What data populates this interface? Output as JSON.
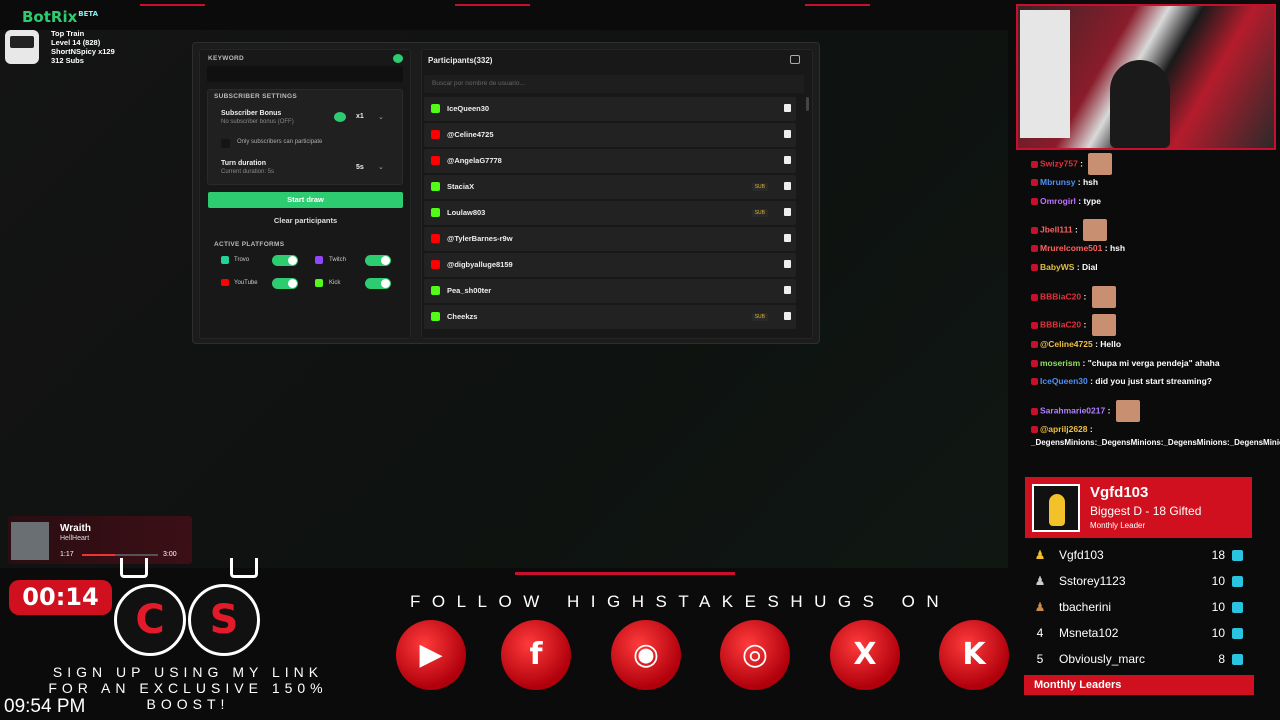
{
  "botrix": {
    "name": "BotRix",
    "beta": "BETA",
    "info": [
      "Top Train",
      "Level 14 (828)",
      "ShortNSpicy x129",
      "312 Subs"
    ]
  },
  "giveaway": {
    "keyword_label": "KEYWORD",
    "subscriber_settings_label": "SUBSCRIBER SETTINGS",
    "subscriber_bonus_label": "Subscriber Bonus",
    "subscriber_bonus_desc": "No subscriber bonus (OFF)",
    "multiplier": "x1",
    "only_subs_label": "Only subscribers can participate",
    "turn_duration_label": "Turn duration",
    "turn_duration_desc": "Current duration: 5s",
    "turn_duration_value": "5s",
    "start_draw": "Start draw",
    "clear_participants": "Clear participants",
    "active_platforms_label": "ACTIVE PLATFORMS",
    "platforms": [
      "Trovo",
      "Twitch",
      "YouTube",
      "Kick"
    ],
    "participants_title": "Participants(332)",
    "search_placeholder": "Buscar por nombre de usuario...",
    "participants": [
      {
        "name": "IceQueen30",
        "platform": "kick",
        "sub": false
      },
      {
        "name": "@Celine4725",
        "platform": "youtube",
        "sub": false
      },
      {
        "name": "@AngelaG7778",
        "platform": "youtube",
        "sub": false
      },
      {
        "name": "StaciaX",
        "platform": "kick",
        "sub": true
      },
      {
        "name": "Loulaw803",
        "platform": "kick",
        "sub": true
      },
      {
        "name": "@TylerBarnes-r9w",
        "platform": "youtube",
        "sub": false
      },
      {
        "name": "@digbyalluge8159",
        "platform": "youtube",
        "sub": false
      },
      {
        "name": "Pea_sh00ter",
        "platform": "kick",
        "sub": false
      },
      {
        "name": "Cheekzs",
        "platform": "kick",
        "sub": true
      }
    ],
    "sub_badge": "SUB"
  },
  "chat": [
    {
      "user": "Swizy757",
      "msg": "",
      "color": "#e0323c"
    },
    {
      "user": "Mbrunsy",
      "msg": "hsh",
      "color": "#4f8ff7"
    },
    {
      "user": "Omrogirl",
      "msg": "type",
      "color": "#c070ff"
    },
    {
      "user": "Jbell111",
      "msg": "",
      "color": "#ff6060"
    },
    {
      "user": "Mrurelcome501",
      "msg": "hsh",
      "color": "#ff6060"
    },
    {
      "user": "BabyWS",
      "msg": "Dial",
      "color": "#e0c040"
    },
    {
      "user": "BBBiaC20",
      "msg": "",
      "color": "#e0323c"
    },
    {
      "user": "BBBiaC20",
      "msg": "",
      "color": "#e0323c"
    },
    {
      "user": "@Celine4725",
      "msg": "Hello",
      "color": "#f0c040"
    },
    {
      "user": "moserism",
      "msg": "\"chupa mi verga pendeja\" ahaha",
      "color": "#90e060"
    },
    {
      "user": "IceQueen30",
      "msg": "did you just start streaming?",
      "color": "#4f8ff7"
    },
    {
      "user": "Sarahmarie0217",
      "msg": "",
      "color": "#b080ff"
    },
    {
      "user": "@aprilj2628",
      "msg": "",
      "color": "#f0c040"
    },
    {
      "user": "",
      "msg": "_DegensMinions:_DegensMinions:_DegensMinions:_DegensMinions:",
      "color": "#fff"
    }
  ],
  "leader": {
    "name": "Vgfd103",
    "title": "Biggest D - 18 Gifted",
    "subtitle": "Monthly Leader"
  },
  "leaderboard": [
    {
      "rank": "",
      "name": "Vgfd103",
      "count": "18"
    },
    {
      "rank": "",
      "name": "Sstorey1123",
      "count": "10"
    },
    {
      "rank": "",
      "name": "tbacherini",
      "count": "10"
    },
    {
      "rank": "4",
      "name": "Msneta102",
      "count": "10"
    },
    {
      "rank": "5",
      "name": "Obviously_marc",
      "count": "8"
    }
  ],
  "monthly_leaders": "Monthly Leaders",
  "now_playing": {
    "title": "Wraith",
    "artist": "HellHeart",
    "elapsed": "1:17",
    "total": "3:00",
    "progress": 0.43
  },
  "timer": "00:14",
  "signup_line1": "SIGN UP USING MY LINK",
  "signup_line2": "FOR AN EXCLUSIVE 150% BOOST!",
  "clock": "09:54 PM",
  "follow_text": "FOLLOW HIGHSTAKESHUGS ON",
  "social_icons": [
    "youtube-icon",
    "facebook-icon",
    "discord-icon",
    "instagram-icon",
    "x-icon",
    "kick-icon"
  ],
  "logos": {
    "c": "C",
    "s": "S",
    "f": "f",
    "x": "X",
    "k": "K",
    "yt": "▶",
    "dc": "◉",
    "ig": "◎"
  }
}
